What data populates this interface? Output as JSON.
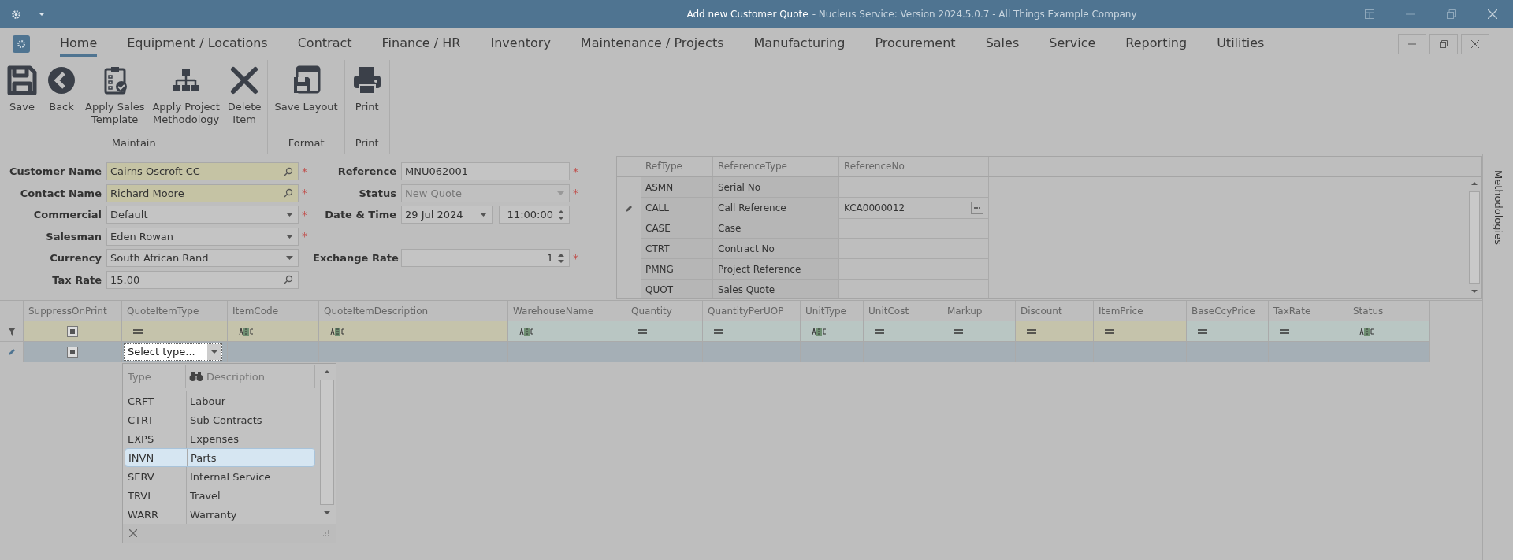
{
  "window": {
    "title": "Add new Customer Quote",
    "subtitle": "- Nucleus Service: Version 2024.5.0.7 - All Things Example Company"
  },
  "menu_tabs": [
    {
      "label": "Home",
      "selected": true
    },
    {
      "label": "Equipment / Locations",
      "selected": false
    },
    {
      "label": "Contract",
      "selected": false
    },
    {
      "label": "Finance / HR",
      "selected": false
    },
    {
      "label": "Inventory",
      "selected": false
    },
    {
      "label": "Maintenance / Projects",
      "selected": false
    },
    {
      "label": "Manufacturing",
      "selected": false
    },
    {
      "label": "Procurement",
      "selected": false
    },
    {
      "label": "Sales",
      "selected": false
    },
    {
      "label": "Service",
      "selected": false
    },
    {
      "label": "Reporting",
      "selected": false
    },
    {
      "label": "Utilities",
      "selected": false
    }
  ],
  "ribbon": [
    {
      "label": "Maintain",
      "buttons": [
        {
          "kind": "save",
          "label": "Save"
        },
        {
          "kind": "back",
          "label": "Back"
        },
        {
          "kind": "template",
          "label": "Apply Sales\nTemplate"
        },
        {
          "kind": "hierarchy",
          "label": "Apply Project\nMethodology"
        },
        {
          "kind": "delete",
          "label": "Delete\nItem"
        }
      ]
    },
    {
      "label": "Format",
      "buttons": [
        {
          "kind": "layout",
          "label": "Save Layout"
        }
      ]
    },
    {
      "label": "Print",
      "buttons": [
        {
          "kind": "print",
          "label": "Print"
        }
      ]
    }
  ],
  "form": {
    "rows": [
      {
        "left": {
          "label": "Customer Name",
          "value": "Cairns Oscroft CC",
          "kind": "search",
          "highlighted": true,
          "required_mark": "*"
        },
        "right": [
          {
            "label": "Reference",
            "value": "MNU062001",
            "kind": "text",
            "required_mark": "*"
          }
        ]
      },
      {
        "left": {
          "label": "Contact Name",
          "value": "Richard Moore",
          "kind": "search",
          "highlighted": true,
          "required_mark": "*"
        },
        "right": [
          {
            "label": "Status",
            "value": "New Quote",
            "kind": "dropdown",
            "disabled": true,
            "required_mark": "*"
          }
        ]
      },
      {
        "left": {
          "label": "Commercial",
          "value": "Default",
          "kind": "dropdown",
          "required_mark": "*"
        },
        "right": [
          {
            "label": "Date & Time",
            "value": "29 Jul 2024",
            "kind": "dropdown"
          },
          {
            "value": "11:00:00",
            "kind": "spin"
          }
        ]
      },
      {
        "left": {
          "label": "Salesman",
          "value": "Eden Rowan",
          "kind": "dropdown",
          "required_mark": "*"
        },
        "right": []
      },
      {
        "left": {
          "label": "Currency",
          "value": "South African Rand",
          "kind": "dropdown"
        },
        "right": [
          {
            "label": "Exchange Rate",
            "value": "1",
            "kind": "spin",
            "required_mark": "*"
          }
        ]
      },
      {
        "left": {
          "label": "Tax Rate",
          "value": "15.00",
          "kind": "search"
        },
        "right": []
      }
    ]
  },
  "references": {
    "columns": [
      "RefType",
      "ReferenceType",
      "ReferenceNo"
    ],
    "rows": [
      {
        "ref_type": "ASMN",
        "reference_type": "Serial No",
        "editing": false
      },
      {
        "ref_type": "CALL",
        "reference_type": "Call Reference",
        "reference_no": "KCA0000012",
        "editing": true
      },
      {
        "ref_type": "CASE",
        "reference_type": "Case",
        "editing": false
      },
      {
        "ref_type": "CTRT",
        "reference_type": "Contract No",
        "editing": false
      },
      {
        "ref_type": "PMNG",
        "reference_type": "Project Reference",
        "editing": false
      },
      {
        "ref_type": "QUOT",
        "reference_type": "Sales Quote",
        "editing": false
      }
    ]
  },
  "items": {
    "columns": [
      {
        "name": "SuppressOnPrint",
        "kind": "checkbox",
        "highlighted": true
      },
      {
        "name": "QuoteItemType",
        "kind": "equals",
        "highlighted": true
      },
      {
        "name": "ItemCode",
        "kind": "text",
        "highlighted": true
      },
      {
        "name": "QuoteItemDescription",
        "kind": "text",
        "highlighted": true
      },
      {
        "name": "WarehouseName",
        "kind": "text",
        "highlighted": false
      },
      {
        "name": "Quantity",
        "kind": "equals",
        "highlighted": false
      },
      {
        "name": "QuantityPerUOP",
        "kind": "equals",
        "highlighted": false
      },
      {
        "name": "UnitType",
        "kind": "text",
        "highlighted": false
      },
      {
        "name": "UnitCost",
        "kind": "equals",
        "highlighted": false
      },
      {
        "name": "Markup",
        "kind": "equals",
        "highlighted": false
      },
      {
        "name": "Discount",
        "kind": "equals",
        "highlighted": true
      },
      {
        "name": "ItemPrice",
        "kind": "equals",
        "highlighted": true
      },
      {
        "name": "BaseCcyPrice",
        "kind": "equals",
        "highlighted": false
      },
      {
        "name": "TaxRate",
        "kind": "equals",
        "highlighted": false
      },
      {
        "name": "Status",
        "kind": "text",
        "highlighted": false
      }
    ],
    "edit_row": {
      "suppress_indeterminate": true
    },
    "type_editor": {
      "placeholder": "Select type..."
    },
    "type_dropdown": {
      "columns": [
        "Type",
        "Description"
      ],
      "rows": [
        {
          "type": "CRFT",
          "description": "Labour",
          "selected": false
        },
        {
          "type": "CTRT",
          "description": "Sub Contracts",
          "selected": false
        },
        {
          "type": "EXPS",
          "description": "Expenses",
          "selected": false
        },
        {
          "type": "INVN",
          "description": "Parts",
          "selected": true
        },
        {
          "type": "SERV",
          "description": "Internal Service",
          "selected": false
        },
        {
          "type": "TRVL",
          "description": "Travel",
          "selected": false
        },
        {
          "type": "WARR",
          "description": "Warranty",
          "selected": false
        }
      ]
    }
  },
  "side_panel": {
    "label": "Methodologies"
  }
}
